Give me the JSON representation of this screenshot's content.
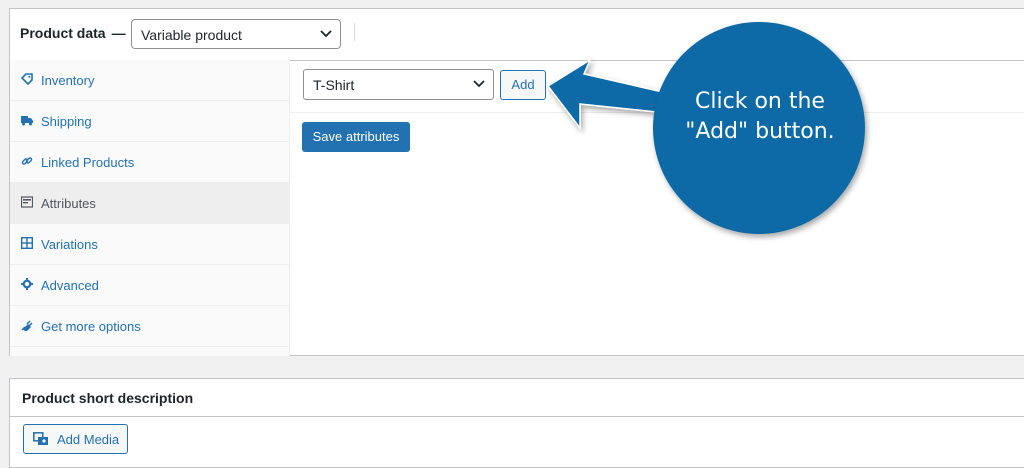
{
  "product_data": {
    "title": "Product data",
    "dash": "—",
    "type_selected": "Variable product"
  },
  "tabs": [
    {
      "label": "Inventory",
      "icon": "tag-icon"
    },
    {
      "label": "Shipping",
      "icon": "truck-icon"
    },
    {
      "label": "Linked Products",
      "icon": "link-icon"
    },
    {
      "label": "Attributes",
      "icon": "list-icon"
    },
    {
      "label": "Variations",
      "icon": "grid-icon"
    },
    {
      "label": "Advanced",
      "icon": "gear-icon"
    },
    {
      "label": "Get more options",
      "icon": "plugin-icon"
    }
  ],
  "active_tab": "Attributes",
  "attributes": {
    "selected": "T-Shirt",
    "add_label": "Add",
    "save_label": "Save attributes"
  },
  "short_description": {
    "title": "Product short description",
    "add_media_label": "Add Media"
  },
  "callout": {
    "line1": "Click on the",
    "line2": "\"Add\" button."
  },
  "colors": {
    "accent": "#2271b1",
    "callout_fill": "#0b6aa6"
  }
}
